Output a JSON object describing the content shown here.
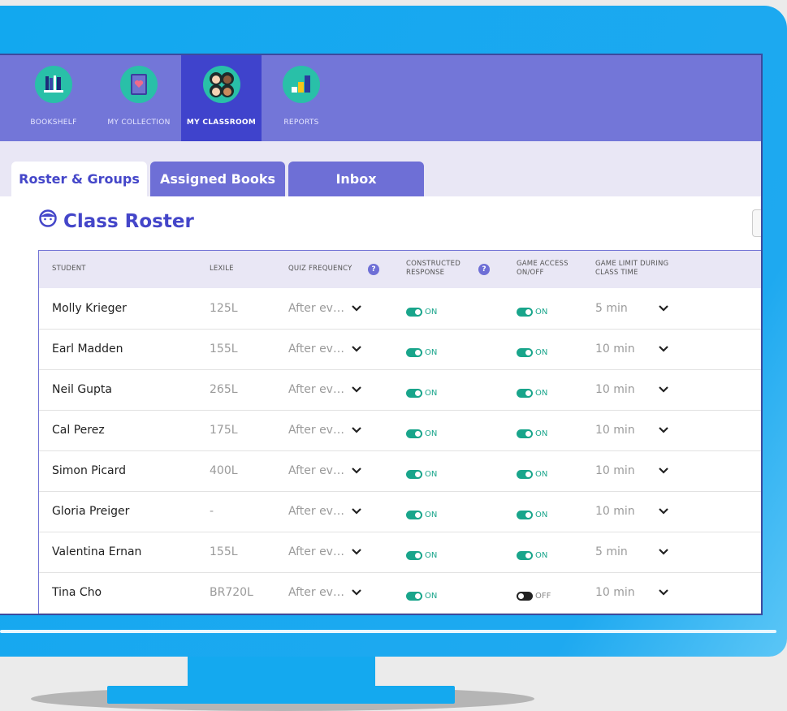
{
  "nav": {
    "items": [
      {
        "label": "BOOKSHELF",
        "icon": "bookshelf-icon"
      },
      {
        "label": "MY COLLECTION",
        "icon": "book-heart-icon"
      },
      {
        "label": "MY CLASSROOM",
        "icon": "students-icon",
        "active": true
      },
      {
        "label": "REPORTS",
        "icon": "bar-chart-icon"
      }
    ]
  },
  "tabs": [
    {
      "label": "Roster & Groups",
      "active": true
    },
    {
      "label": "Assigned Books",
      "active": false
    },
    {
      "label": "Inbox",
      "active": false
    }
  ],
  "roster": {
    "title": "Class Roster",
    "columns": {
      "student": "STUDENT",
      "lexile": "LEXILE",
      "quiz": "QUIZ FREQUENCY",
      "constructed_1": "CONSTRUCTED",
      "constructed_2": "RESPONSE",
      "game_1": "GAME ACCESS",
      "game_2": "ON/OFF",
      "limit_1": "GAME LIMIT DURING",
      "limit_2": "CLASS TIME",
      "help": "?"
    },
    "rows": [
      {
        "name": "Molly Krieger",
        "lexile": "125L",
        "quiz": "After ev…",
        "constructed": "ON",
        "game": "ON",
        "limit": "5 min"
      },
      {
        "name": "Earl Madden",
        "lexile": "155L",
        "quiz": "After ev…",
        "constructed": "ON",
        "game": "ON",
        "limit": "10 min"
      },
      {
        "name": "Neil Gupta",
        "lexile": "265L",
        "quiz": "After ev…",
        "constructed": "ON",
        "game": "ON",
        "limit": "10 min"
      },
      {
        "name": "Cal Perez",
        "lexile": "175L",
        "quiz": "After ev…",
        "constructed": "ON",
        "game": "ON",
        "limit": "10 min"
      },
      {
        "name": "Simon Picard",
        "lexile": "400L",
        "quiz": "After ev…",
        "constructed": "ON",
        "game": "ON",
        "limit": "10 min"
      },
      {
        "name": "Gloria Preiger",
        "lexile": "-",
        "quiz": "After ev…",
        "constructed": "ON",
        "game": "ON",
        "limit": "10 min"
      },
      {
        "name": "Valentina Ernan",
        "lexile": "155L",
        "quiz": "After ev…",
        "constructed": "ON",
        "game": "ON",
        "limit": "5 min"
      },
      {
        "name": "Tina Cho",
        "lexile": "BR720L",
        "quiz": "After ev…",
        "constructed": "ON",
        "game": "OFF",
        "limit": "10 min"
      }
    ]
  },
  "colors": {
    "accent": "#4446c9",
    "nav": "#7376d8",
    "toggle_on": "#19a58b",
    "toggle_off": "#222222",
    "bezel": "#12a8ef"
  }
}
